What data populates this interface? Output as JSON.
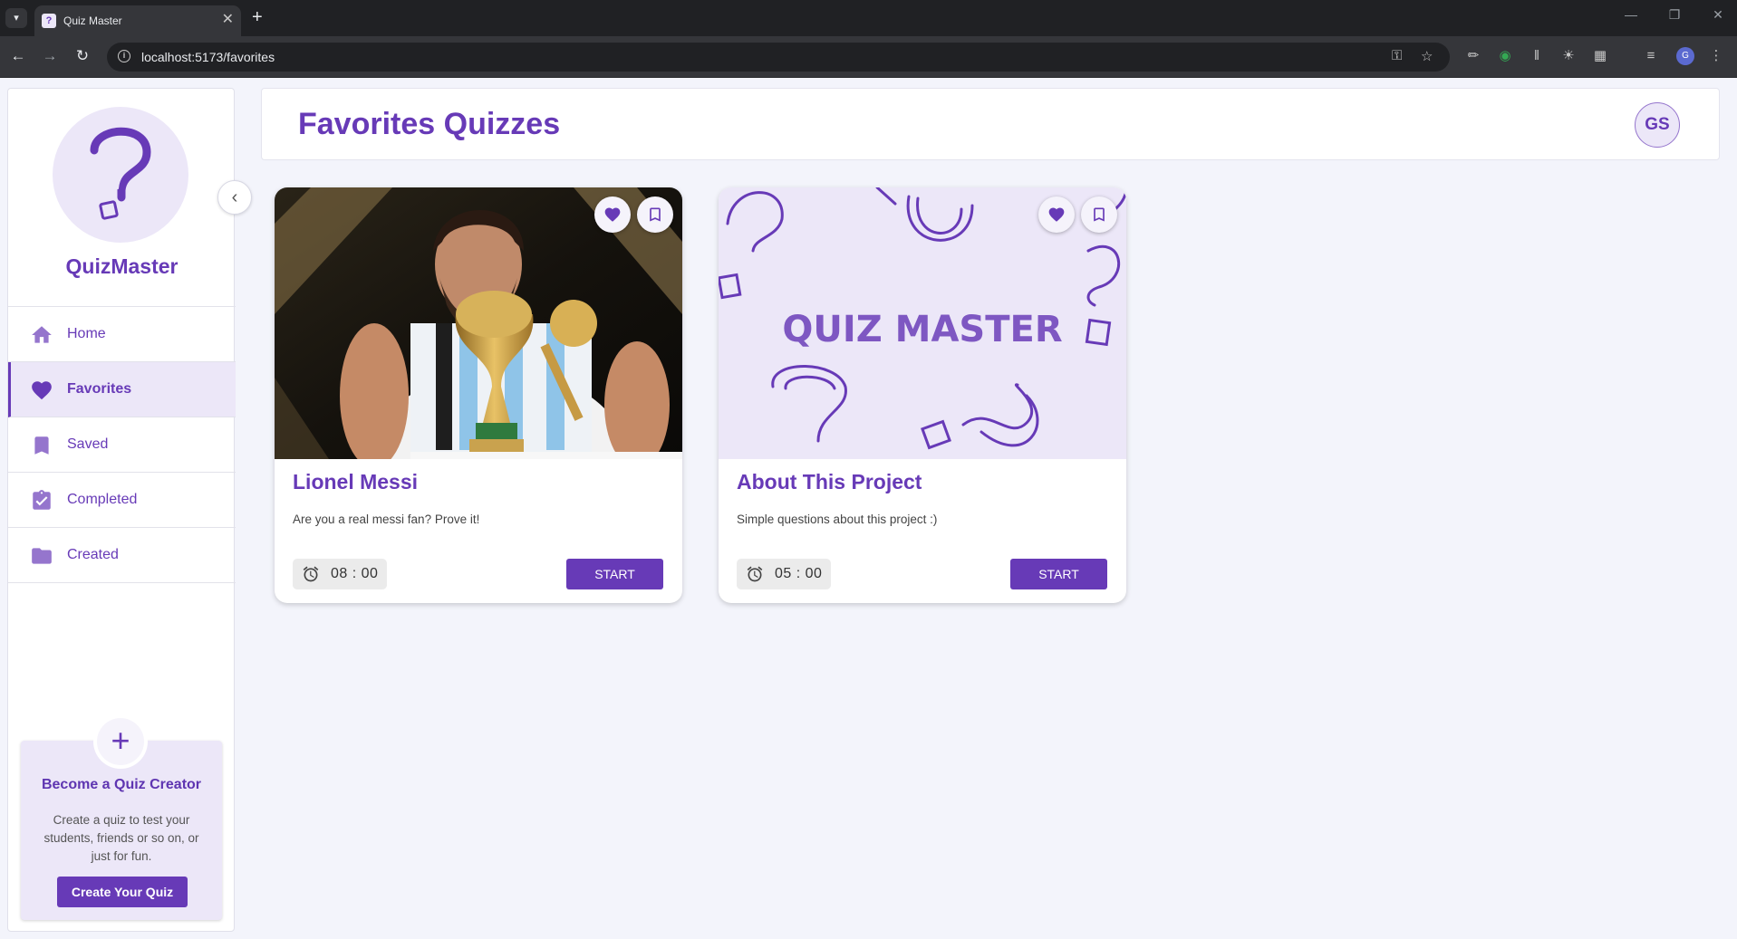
{
  "browser": {
    "tab_title": "Quiz Master",
    "url": "localhost:5173/favorites",
    "profile_initial": "G"
  },
  "sidebar": {
    "brand": "QuizMaster",
    "items": [
      {
        "label": "Home",
        "icon": "home-icon"
      },
      {
        "label": "Favorites",
        "icon": "heart-icon",
        "active": true
      },
      {
        "label": "Saved",
        "icon": "bookmark-icon"
      },
      {
        "label": "Completed",
        "icon": "clipboard-check-icon"
      },
      {
        "label": "Created",
        "icon": "folder-icon"
      }
    ],
    "creator": {
      "title": "Become a Quiz Creator",
      "description": "Create a quiz to test your students, friends or so on, or just for fun.",
      "button": "Create Your Quiz"
    }
  },
  "header": {
    "title": "Favorites Quizzes",
    "avatar": "GS"
  },
  "quizzes": [
    {
      "title": "Lionel Messi",
      "description": "Are you a real messi fan? Prove it!",
      "timer": "08 : 00",
      "button": "START",
      "image": "messi-photo"
    },
    {
      "title": "About This Project",
      "description": "Simple questions about this project :)",
      "timer": "05 : 00",
      "button": "START",
      "image": "quiz-master-banner",
      "image_text": "QUIZ MASTER"
    }
  ],
  "colors": {
    "primary": "#673ab7",
    "primary_light": "#ece7f8",
    "background": "#f3f4fb"
  }
}
